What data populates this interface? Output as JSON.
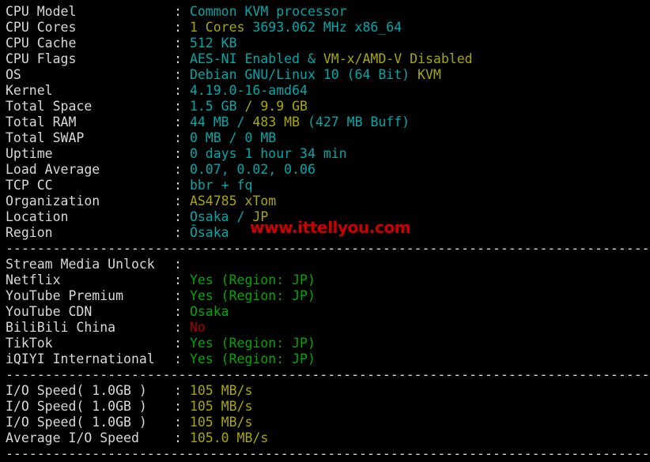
{
  "terminal": {
    "background": "#000000",
    "colors": {
      "label": "#d8d8d8",
      "cyan": "#00a8a8",
      "yellow": "#a8a800",
      "green": "#00a800",
      "red": "#a80000",
      "watermark": "#cc0000"
    },
    "separator": "----------------------------------------------------------------------------------"
  },
  "watermark": {
    "text": "www.ittellyou.com"
  },
  "sections": [
    {
      "name": "system-info",
      "rows": [
        {
          "label": "CPU Model",
          "parts": [
            {
              "text": "Common KVM processor",
              "color": "cyan"
            }
          ]
        },
        {
          "label": "CPU Cores",
          "parts": [
            {
              "text": "1 Cores ",
              "color": "yellow"
            },
            {
              "text": "3693.062 MHz x86_64",
              "color": "cyan"
            }
          ]
        },
        {
          "label": "CPU Cache",
          "parts": [
            {
              "text": "512 KB",
              "color": "cyan"
            }
          ]
        },
        {
          "label": "CPU Flags",
          "parts": [
            {
              "text": "AES-NI Enabled & ",
              "color": "cyan"
            },
            {
              "text": "VM-x/AMD-V Disabled",
              "color": "yellow"
            }
          ]
        },
        {
          "label": "OS",
          "parts": [
            {
              "text": "Debian GNU/Linux 10 (64 Bit) ",
              "color": "cyan"
            },
            {
              "text": "KVM",
              "color": "yellow"
            }
          ]
        },
        {
          "label": "Kernel",
          "parts": [
            {
              "text": "4.19.0-16-amd64",
              "color": "cyan"
            }
          ]
        },
        {
          "label": "Total Space",
          "parts": [
            {
              "text": "1.5 GB ",
              "color": "cyan"
            },
            {
              "text": "/ 9.9 GB",
              "color": "yellow"
            }
          ]
        },
        {
          "label": "Total RAM",
          "parts": [
            {
              "text": "44 MB / ",
              "color": "cyan"
            },
            {
              "text": "483 MB ",
              "color": "yellow"
            },
            {
              "text": "(427 MB Buff)",
              "color": "cyan"
            }
          ]
        },
        {
          "label": "Total SWAP",
          "parts": [
            {
              "text": "0 MB / 0 MB",
              "color": "cyan"
            }
          ]
        },
        {
          "label": "Uptime",
          "parts": [
            {
              "text": "0 days 1 hour 34 min",
              "color": "cyan"
            }
          ]
        },
        {
          "label": "Load Average",
          "parts": [
            {
              "text": "0.07, 0.02, 0.06",
              "color": "cyan"
            }
          ]
        },
        {
          "label": "TCP CC",
          "parts": [
            {
              "text": "bbr + fq",
              "color": "cyan"
            }
          ]
        },
        {
          "label": "Organization",
          "parts": [
            {
              "text": "AS4785 xTom",
              "color": "yellow"
            }
          ]
        },
        {
          "label": "Location",
          "parts": [
            {
              "text": "Osaka / ",
              "color": "cyan"
            },
            {
              "text": "JP",
              "color": "yellow"
            }
          ]
        },
        {
          "label": "Region",
          "parts": [
            {
              "text": "Ōsaka",
              "color": "cyan"
            }
          ]
        }
      ]
    },
    {
      "name": "stream-media-unlock",
      "rows": [
        {
          "label": "Stream Media Unlock",
          "parts": []
        },
        {
          "label": "Netflix",
          "parts": [
            {
              "text": "Yes (Region: JP)",
              "color": "green"
            }
          ]
        },
        {
          "label": "YouTube Premium",
          "parts": [
            {
              "text": "Yes (Region: JP)",
              "color": "green"
            }
          ]
        },
        {
          "label": "YouTube CDN",
          "parts": [
            {
              "text": "Osaka",
              "color": "green"
            }
          ]
        },
        {
          "label": "BiliBili China",
          "parts": [
            {
              "text": "No",
              "color": "red"
            }
          ]
        },
        {
          "label": "TikTok",
          "parts": [
            {
              "text": "Yes (Region: JP)",
              "color": "green"
            }
          ]
        },
        {
          "label": "iQIYI International",
          "parts": [
            {
              "text": "Yes (Region: JP)",
              "color": "green"
            }
          ]
        }
      ]
    },
    {
      "name": "io-speed",
      "rows": [
        {
          "label": "I/O Speed( 1.0GB )",
          "parts": [
            {
              "text": "105 MB/s",
              "color": "yellow"
            }
          ]
        },
        {
          "label": "I/O Speed( 1.0GB )",
          "parts": [
            {
              "text": "105 MB/s",
              "color": "yellow"
            }
          ]
        },
        {
          "label": "I/O Speed( 1.0GB )",
          "parts": [
            {
              "text": "105 MB/s",
              "color": "yellow"
            }
          ]
        },
        {
          "label": "Average I/O Speed",
          "parts": [
            {
              "text": "105.0 MB/s",
              "color": "yellow"
            }
          ]
        }
      ]
    }
  ]
}
